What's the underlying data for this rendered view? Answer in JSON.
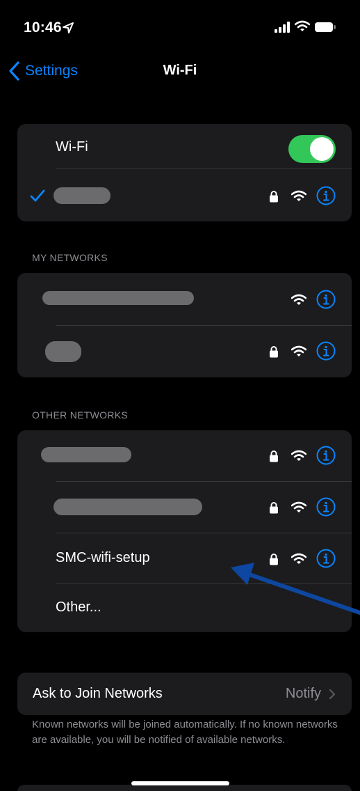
{
  "status_bar": {
    "time": "10:46"
  },
  "nav": {
    "back_label": "Settings",
    "title": "Wi-Fi"
  },
  "wifi_group": {
    "toggle_label": "Wi-Fi",
    "toggle_on": true
  },
  "my_networks": {
    "header": "MY NETWORKS"
  },
  "other_networks": {
    "header": "OTHER NETWORKS",
    "named_network": "SMC-wifi-setup",
    "other_label": "Other..."
  },
  "ask_to_join": {
    "label": "Ask to Join Networks",
    "value": "Notify"
  },
  "footer": {
    "text": "Known networks will be joined automatically. If no known networks are available, you will be notified of available networks."
  },
  "icons": {
    "location": "location-arrow-icon",
    "cellular": "cellular-signal-icon",
    "wifi": "wifi-icon",
    "battery": "battery-icon",
    "lock": "lock-icon",
    "info": "info-icon",
    "checkmark": "checkmark-icon",
    "chevron": "chevron-right-icon"
  },
  "colors": {
    "accent": "#0a84ff",
    "toggle_on": "#33c759",
    "annotation_arrow": "#0d47a1"
  }
}
